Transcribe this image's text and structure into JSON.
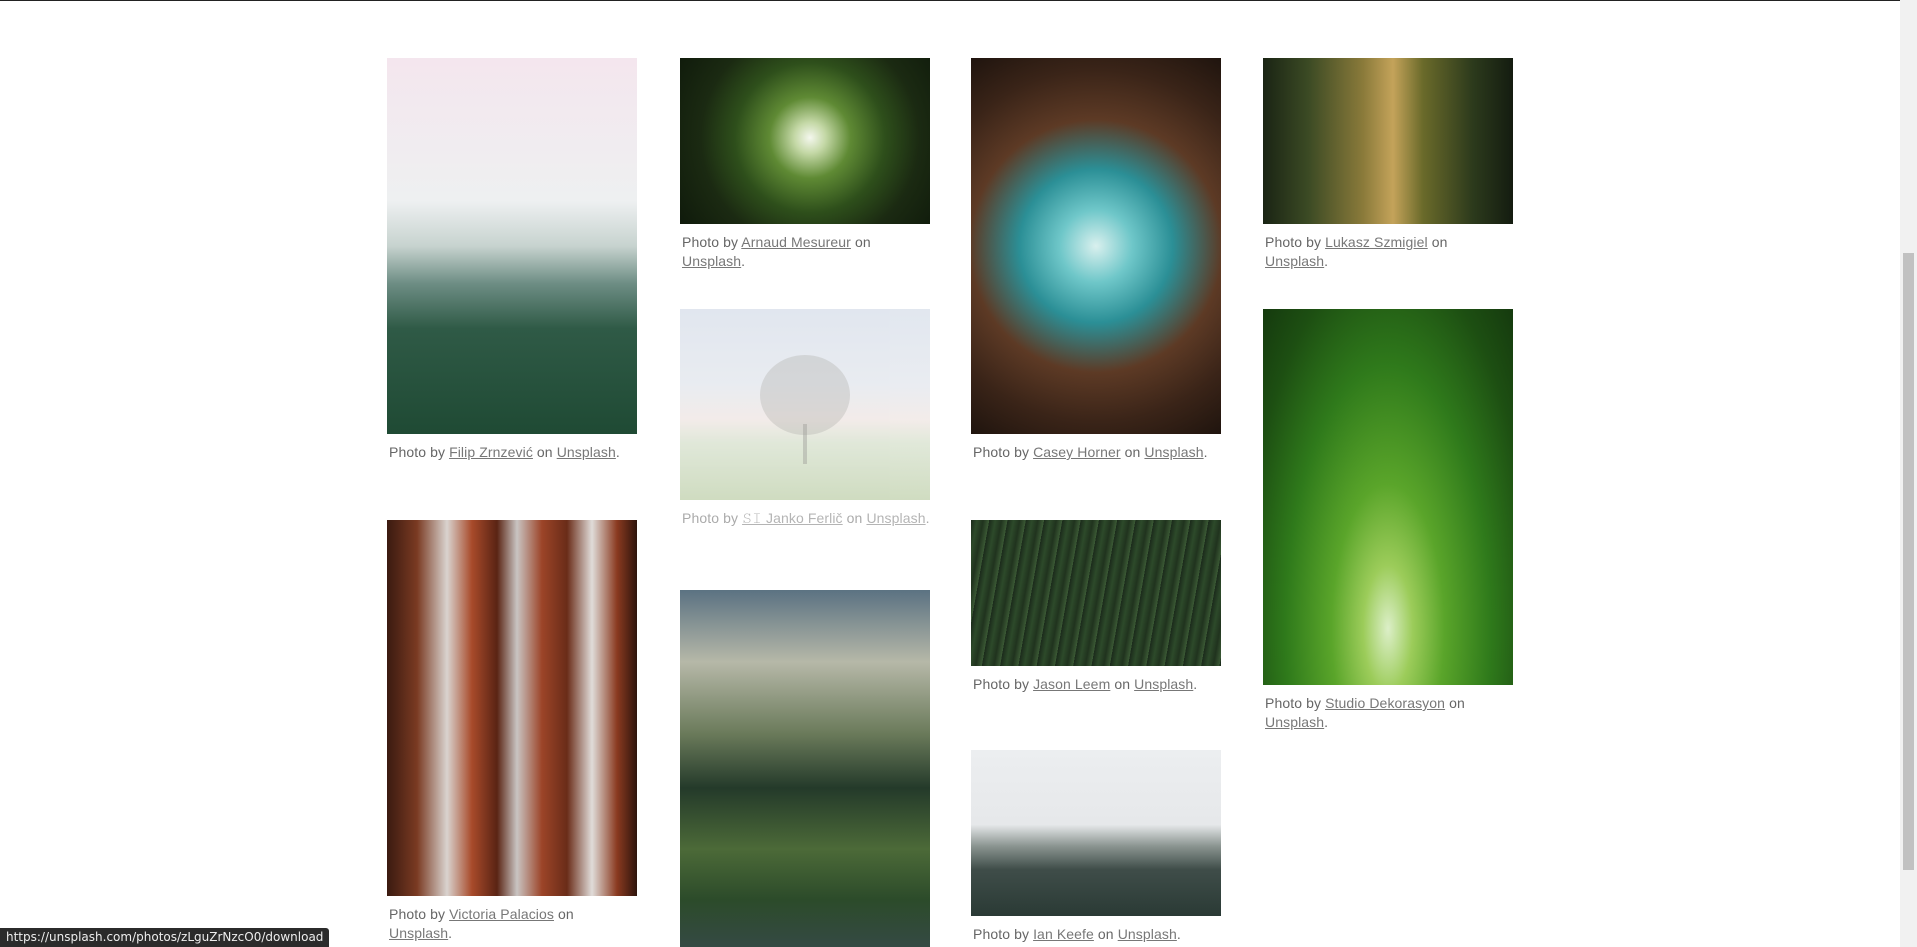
{
  "status_url": "https://unsplash.com/photos/zLguZrNzcO0/download",
  "caption_words": {
    "photo_by": "Photo by",
    "on": "on",
    "site": "Unsplash",
    "period": "."
  },
  "photos": [
    {
      "author": "Filip Zrnzević",
      "subject": "misty-forest"
    },
    {
      "author": "Victoria Palacios",
      "subject": "sequoia-trunks"
    },
    {
      "author": "Arnaud Mesureur",
      "subject": "canopy-looking-up"
    },
    {
      "author": "𝚂𝙸 Janko Ferlič",
      "subject": "lone-tree-in-fog"
    },
    {
      "author": "Casey Horner",
      "subject": "redwoods-looking-up"
    },
    {
      "author": "Jason Leem",
      "subject": "pine-forest-aerial"
    },
    {
      "author": "Ian Keefe",
      "subject": "snowy-pines"
    },
    {
      "author": "Lukasz Szmigiel",
      "subject": "forest-path"
    },
    {
      "author": "Studio Dekorasyon",
      "subject": "green-tree-tunnel"
    },
    {
      "author": "",
      "subject": "river-valley"
    }
  ]
}
